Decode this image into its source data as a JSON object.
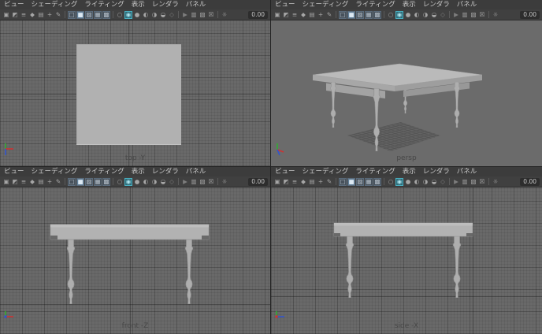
{
  "viewport_menu": {
    "items": [
      {
        "name": "menu-view",
        "label": "ビュー"
      },
      {
        "name": "menu-shading",
        "label": "シェーディング"
      },
      {
        "name": "menu-lighting",
        "label": "ライティング"
      },
      {
        "name": "menu-show",
        "label": "表示"
      },
      {
        "name": "menu-renderer",
        "label": "レンダラ"
      },
      {
        "name": "menu-panels",
        "label": "パネル"
      }
    ]
  },
  "viewport_toolbar": {
    "exposure_value": "0.00",
    "icons": [
      {
        "name": "select-camera-icon",
        "glyph": "▣"
      },
      {
        "name": "lock-camera-icon",
        "glyph": "◩"
      },
      {
        "name": "camera-attributes-icon",
        "glyph": "≡"
      },
      {
        "name": "bookmarks-icon",
        "glyph": "◆"
      },
      {
        "name": "image-plane-icon",
        "glyph": "▤"
      },
      {
        "name": "pan-zoom-icon",
        "glyph": "+"
      },
      {
        "name": "grease-pencil-icon",
        "glyph": "✎"
      },
      {
        "name": "separator",
        "style": "sep"
      },
      {
        "name": "wireframe-mode-icon",
        "glyph": "□",
        "style": "boxed"
      },
      {
        "name": "smooth-shade-mode-icon",
        "glyph": "■",
        "style": "boxed active"
      },
      {
        "name": "textured-mode-icon",
        "glyph": "▨",
        "style": "boxed"
      },
      {
        "name": "use-all-lights-icon",
        "glyph": "▦",
        "style": "boxed"
      },
      {
        "name": "shadow-mode-icon",
        "glyph": "▩",
        "style": "boxed"
      },
      {
        "name": "separator",
        "style": "sep"
      },
      {
        "name": "occlusion-icon",
        "glyph": "○"
      },
      {
        "name": "isolate-select-icon",
        "glyph": "◉",
        "style": "teal"
      },
      {
        "name": "default-material-icon",
        "glyph": "●"
      },
      {
        "name": "wireframe-on-shaded-icon",
        "glyph": "◐"
      },
      {
        "name": "textured-sphere-icon",
        "glyph": "◑"
      },
      {
        "name": "material-override-icon",
        "glyph": "◒"
      },
      {
        "name": "xray-mode-icon",
        "glyph": "◇",
        "style": "dim"
      },
      {
        "name": "separator",
        "style": "sep"
      },
      {
        "name": "selection-cursor-icon",
        "glyph": "▶",
        "style": "dim"
      },
      {
        "name": "film-gate-icon",
        "glyph": "▥"
      },
      {
        "name": "resolution-gate-icon",
        "glyph": "▧"
      },
      {
        "name": "gate-mask-icon",
        "glyph": "☒"
      },
      {
        "name": "separator",
        "style": "sep"
      },
      {
        "name": "exposure-icon",
        "glyph": "☼"
      }
    ]
  },
  "panels": [
    {
      "id": "top",
      "label": "top -Y"
    },
    {
      "id": "persp",
      "label": "persp"
    },
    {
      "id": "front",
      "label": "front -Z"
    },
    {
      "id": "side",
      "label": "side -X"
    }
  ],
  "colors": {
    "panel_chrome": "#3c3c3c",
    "toolbar_bg": "#404040",
    "viewport_background": "#696969",
    "grid_line": "#5e5e5e",
    "model_gray": "#b2b2b2",
    "teal_accent": "#49aebf",
    "shading_active_blue": "#5f7d96",
    "axis_x_red": "#cc3333",
    "axis_y_green": "#33aa33",
    "axis_z_blue": "#3355cc",
    "view_label_gray": "#474747",
    "exposure_box_bg": "#2d2d2d"
  }
}
